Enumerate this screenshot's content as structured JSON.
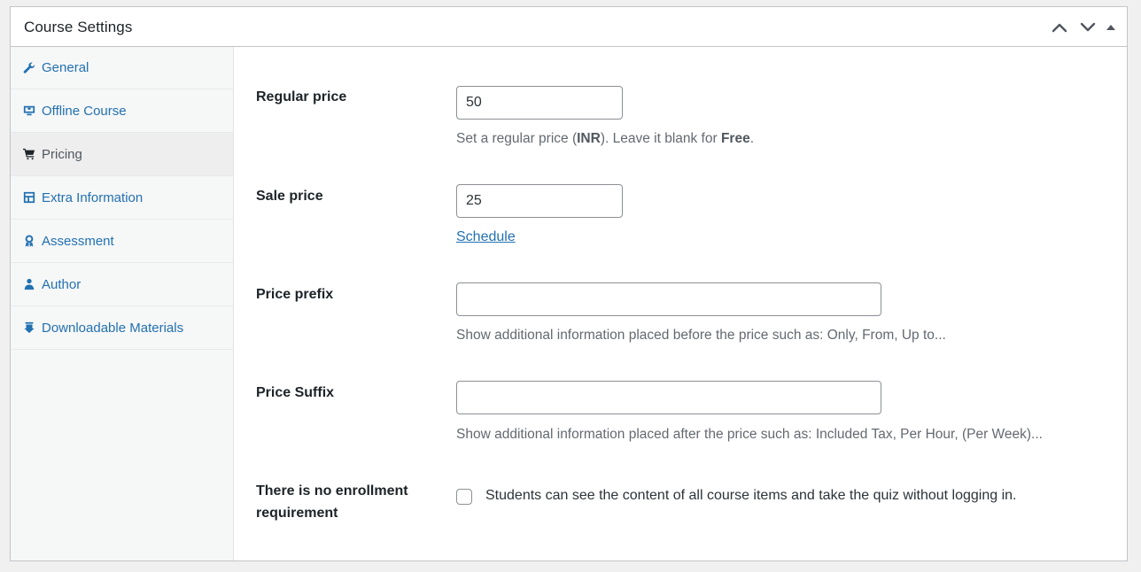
{
  "panel": {
    "title": "Course Settings"
  },
  "header_actions": {
    "up_icon": "chevron-up-icon",
    "down_icon": "chevron-down-icon",
    "toggle_icon": "triangle-up-icon"
  },
  "tabs": [
    {
      "label": "General",
      "icon": "wrench-icon",
      "active": false
    },
    {
      "label": "Offline Course",
      "icon": "screen-icon",
      "active": false
    },
    {
      "label": "Pricing",
      "icon": "cart-icon",
      "active": true
    },
    {
      "label": "Extra Information",
      "icon": "layout-icon",
      "active": false
    },
    {
      "label": "Assessment",
      "icon": "award-icon",
      "active": false
    },
    {
      "label": "Author",
      "icon": "user-icon",
      "active": false
    },
    {
      "label": "Downloadable Materials",
      "icon": "download-icon",
      "active": false
    }
  ],
  "pricing": {
    "regular_price": {
      "label": "Regular price",
      "value": "50",
      "desc_prefix": "Set a regular price (",
      "desc_currency": "INR",
      "desc_middle": "). Leave it blank for ",
      "desc_free": "Free",
      "desc_suffix": "."
    },
    "sale_price": {
      "label": "Sale price",
      "value": "25",
      "schedule_link": "Schedule"
    },
    "price_prefix": {
      "label": "Price prefix",
      "value": "",
      "desc": "Show additional information placed before the price such as: Only, From, Up to..."
    },
    "price_suffix": {
      "label": "Price Suffix",
      "value": "",
      "desc": "Show additional information placed after the price such as: Included Tax, Per Hour, (Per Week)..."
    },
    "no_enrollment": {
      "label_line1": "There is no enrollment",
      "label_line2": "requirement",
      "checked": false,
      "desc": "Students can see the content of all course items and take the quiz without logging in."
    }
  },
  "colors": {
    "link": "#2271b1",
    "text": "#1d2327",
    "muted": "#646970",
    "border": "#c3c4c7",
    "sidebar_bg": "#f6f7f7",
    "active_tab_bg": "#eeeeee"
  }
}
